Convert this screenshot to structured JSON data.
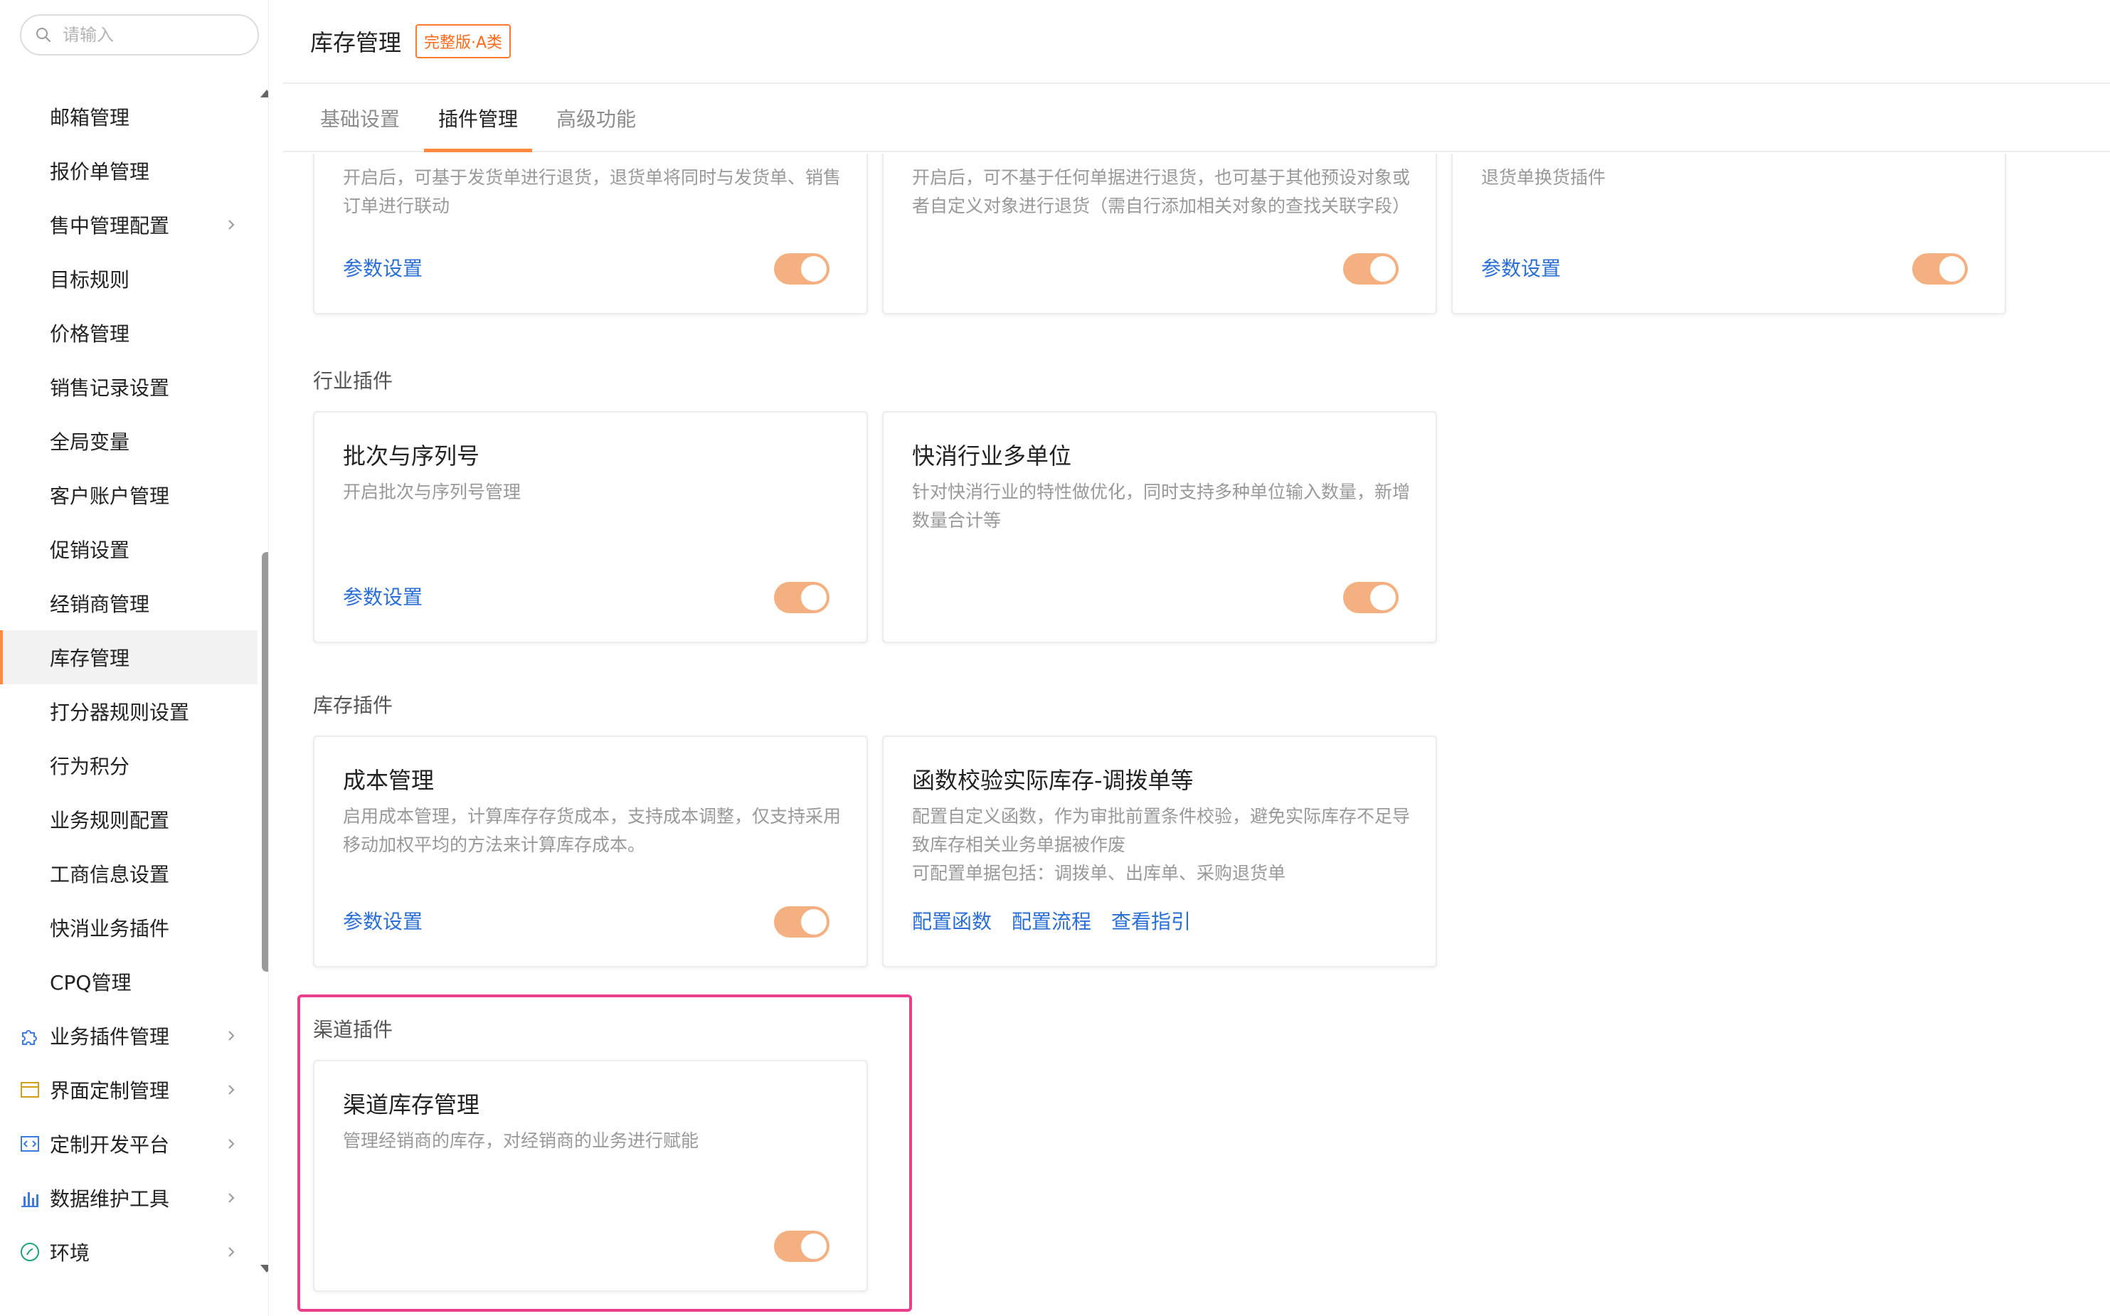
{
  "colors": {
    "accent": "#ff8a3d",
    "toggle_on": "#f4b080",
    "link": "#2a6fd6",
    "highlight": "#e83e8c"
  },
  "sidebar": {
    "search_placeholder": "请输入",
    "items": [
      {
        "label": "邮箱管理"
      },
      {
        "label": "报价单管理"
      },
      {
        "label": "售中管理配置"
      },
      {
        "label": "目标规则"
      },
      {
        "label": "价格管理"
      },
      {
        "label": "销售记录设置"
      },
      {
        "label": "全局变量"
      },
      {
        "label": "客户账户管理"
      },
      {
        "label": "促销设置"
      },
      {
        "label": "经销商管理"
      },
      {
        "label": "库存管理"
      },
      {
        "label": "打分器规则设置"
      },
      {
        "label": "行为积分"
      },
      {
        "label": "业务规则配置"
      },
      {
        "label": "工商信息设置"
      },
      {
        "label": "快消业务插件"
      },
      {
        "label": "CPQ管理"
      },
      {
        "label": "业务插件管理",
        "icon": "puzzle-icon"
      },
      {
        "label": "界面定制管理",
        "icon": "window-icon"
      },
      {
        "label": "定制开发平台",
        "icon": "code-icon"
      },
      {
        "label": "数据维护工具",
        "icon": "bar-chart-icon"
      },
      {
        "label": "环境",
        "icon": "env-icon"
      }
    ]
  },
  "header": {
    "title": "库存管理",
    "badge": "完整版·A类"
  },
  "tabs": [
    {
      "label": "基础设置"
    },
    {
      "label": "插件管理"
    },
    {
      "label": "高级功能"
    }
  ],
  "top_cards": [
    {
      "desc": "开启后，可基于发货单进行退货，退货单将同时与发货单、销售订单进行联动",
      "link": "参数设置"
    },
    {
      "desc": "开启后，可不基于任何单据进行退货，也可基于其他预设对象或者自定义对象进行退货（需自行添加相关对象的查找关联字段）"
    },
    {
      "desc": "退货单换货插件",
      "link": "参数设置"
    }
  ],
  "sections": {
    "industry": {
      "title": "行业插件",
      "cards": [
        {
          "title": "批次与序列号",
          "desc": "开启批次与序列号管理",
          "link": "参数设置"
        },
        {
          "title": "快消行业多单位",
          "desc": "针对快消行业的特性做优化，同时支持多种单位输入数量，新增数量合计等"
        }
      ]
    },
    "inventory": {
      "title": "库存插件",
      "cards": [
        {
          "title": "成本管理",
          "desc": "启用成本管理，计算库存存货成本，支持成本调整，仅支持采用移动加权平均的方法来计算库存成本。",
          "link": "参数设置"
        },
        {
          "title": "函数校验实际库存-调拨单等",
          "desc": "配置自定义函数，作为审批前置条件校验，避免实际库存不足导致库存相关业务单据被作废",
          "desc2": "可配置单据包括：调拨单、出库单、采购退货单",
          "links": [
            "配置函数",
            "配置流程",
            "查看指引"
          ]
        }
      ]
    },
    "channel": {
      "title": "渠道插件",
      "cards": [
        {
          "title": "渠道库存管理",
          "desc": "管理经销商的库存，对经销商的业务进行赋能"
        }
      ]
    }
  }
}
